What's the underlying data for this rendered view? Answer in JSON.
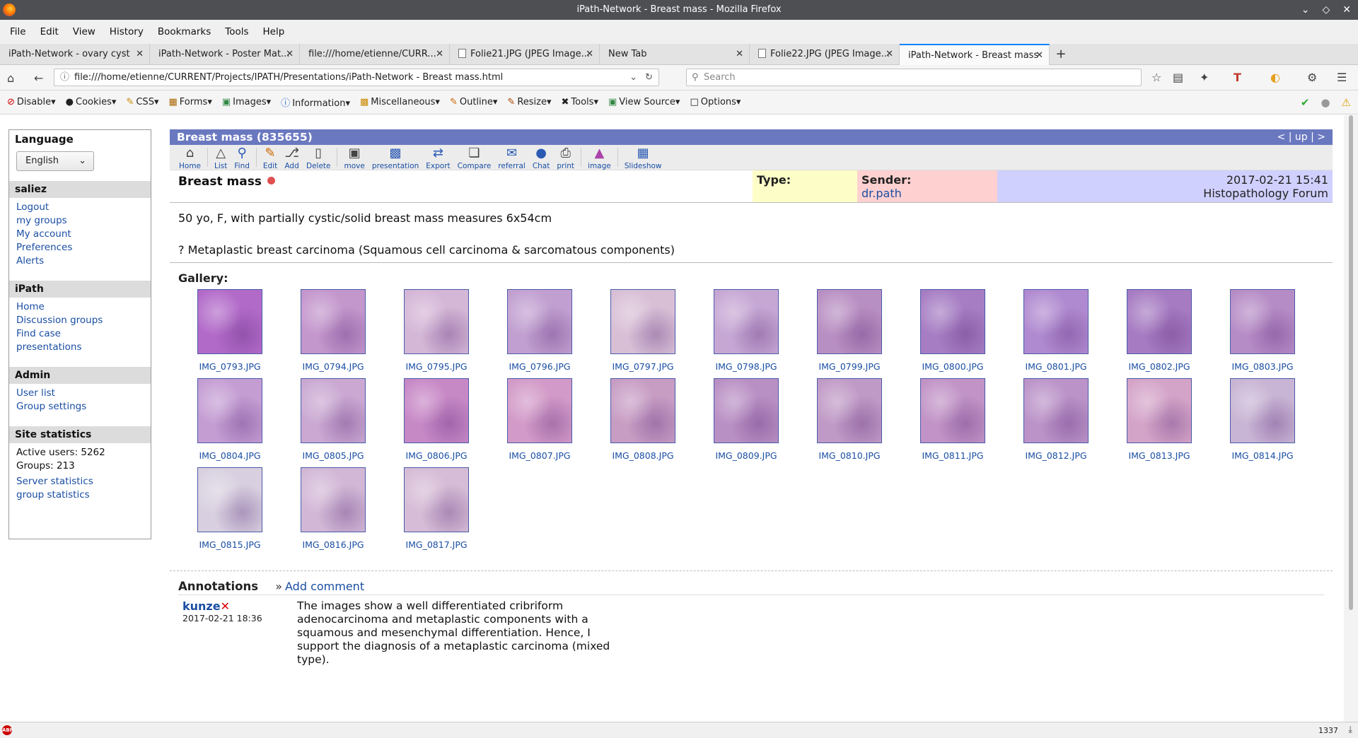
{
  "window": {
    "title": "iPath-Network - Breast mass - Mozilla Firefox"
  },
  "menu": [
    "File",
    "Edit",
    "View",
    "History",
    "Bookmarks",
    "Tools",
    "Help"
  ],
  "tabs": [
    {
      "label": "iPath-Network - ovary cyst"
    },
    {
      "label": "iPath-Network - Poster Mat..."
    },
    {
      "label": "file:///home/etienne/CURR..."
    },
    {
      "label": "Folie21.JPG (JPEG Image..."
    },
    {
      "label": "New Tab"
    },
    {
      "label": "Folie22.JPG (JPEG Image..."
    },
    {
      "label": "iPath-Network - Breast mass"
    }
  ],
  "nav": {
    "url": "file:///home/etienne/CURRENT/Projects/IPATH/Presentations/iPath-Network - Breast mass.html",
    "search_placeholder": "Search"
  },
  "devbar": [
    "Disable",
    "Cookies",
    "CSS",
    "Forms",
    "Images",
    "Information",
    "Miscellaneous",
    "Outline",
    "Resize",
    "Tools",
    "View Source",
    "Options"
  ],
  "sidebar": {
    "language_title": "Language",
    "language_value": "English",
    "user_title": "saliez",
    "user_links": [
      "Logout",
      "my groups",
      "My account",
      "Preferences",
      "Alerts"
    ],
    "ipath_title": "iPath",
    "ipath_links": [
      "Home",
      "Discussion groups",
      "Find case",
      "presentations"
    ],
    "admin_title": "Admin",
    "admin_links": [
      "User list",
      "Group settings"
    ],
    "stats_title": "Site statistics",
    "active_users": "Active users: 5262",
    "groups": "Groups: 213",
    "stats_links": [
      "Server statistics",
      "group statistics"
    ]
  },
  "case": {
    "header": "Breast mass (835655)",
    "nav": "< | up | >",
    "title": "Breast mass",
    "type_label": "Type:",
    "sender_label": "Sender:",
    "sender": "dr.path",
    "datetime": "2017-02-21 15:41",
    "group": "Histopathology Forum",
    "description": "50 yo, F, with partially cystic/solid breast mass measures 6x54cm",
    "diagnosis": "? Metaplastic breast carcinoma (Squamous cell carcinoma & sarcomatous components)",
    "gallery_title": "Gallery:"
  },
  "toolbar": [
    "Home",
    "List",
    "Find",
    "Edit",
    "Add",
    "Delete",
    "move",
    "presentation",
    "Export",
    "Compare",
    "referral",
    "Chat",
    "print",
    "image",
    "Slideshow"
  ],
  "images": [
    {
      "name": "IMG_0793.JPG",
      "color": "#b26ac9"
    },
    {
      "name": "IMG_0794.JPG",
      "color": "#c396cc"
    },
    {
      "name": "IMG_0795.JPG",
      "color": "#d4b6d6"
    },
    {
      "name": "IMG_0796.JPG",
      "color": "#c19fd0"
    },
    {
      "name": "IMG_0797.JPG",
      "color": "#d8bfd6"
    },
    {
      "name": "IMG_0798.JPG",
      "color": "#c6a7d4"
    },
    {
      "name": "IMG_0799.JPG",
      "color": "#b88fc2"
    },
    {
      "name": "IMG_0800.JPG",
      "color": "#a67dc3"
    },
    {
      "name": "IMG_0801.JPG",
      "color": "#b08ad0"
    },
    {
      "name": "IMG_0802.JPG",
      "color": "#a67bc2"
    },
    {
      "name": "IMG_0803.JPG",
      "color": "#b68cc6"
    },
    {
      "name": "IMG_0804.JPG",
      "color": "#c49dd3"
    },
    {
      "name": "IMG_0805.JPG",
      "color": "#caa8d2"
    },
    {
      "name": "IMG_0806.JPG",
      "color": "#c788c6"
    },
    {
      "name": "IMG_0807.JPG",
      "color": "#d29ac8"
    },
    {
      "name": "IMG_0808.JPG",
      "color": "#c79dc4"
    },
    {
      "name": "IMG_0809.JPG",
      "color": "#b990c4"
    },
    {
      "name": "IMG_0810.JPG",
      "color": "#c09ac6"
    },
    {
      "name": "IMG_0811.JPG",
      "color": "#c193c6"
    },
    {
      "name": "IMG_0812.JPG",
      "color": "#bb93c8"
    },
    {
      "name": "IMG_0813.JPG",
      "color": "#d4a4c8"
    },
    {
      "name": "IMG_0814.JPG",
      "color": "#c8b4d4"
    },
    {
      "name": "IMG_0815.JPG",
      "color": "#d8d0e0"
    },
    {
      "name": "IMG_0816.JPG",
      "color": "#d2b8d6"
    },
    {
      "name": "IMG_0817.JPG",
      "color": "#d6bcd6"
    }
  ],
  "annotations": {
    "title": "Annotations",
    "add_comment": "Add comment",
    "author": "kunze",
    "date": "2017-02-21 18:36",
    "text": "The images show a well differentiated cribriform adenocarcinoma and metaplastic components with a squamous and mesenchymal differentiation. Hence, I support the diagnosis of a metaplastic carcinoma (mixed type)."
  },
  "status": {
    "count": "1337"
  }
}
